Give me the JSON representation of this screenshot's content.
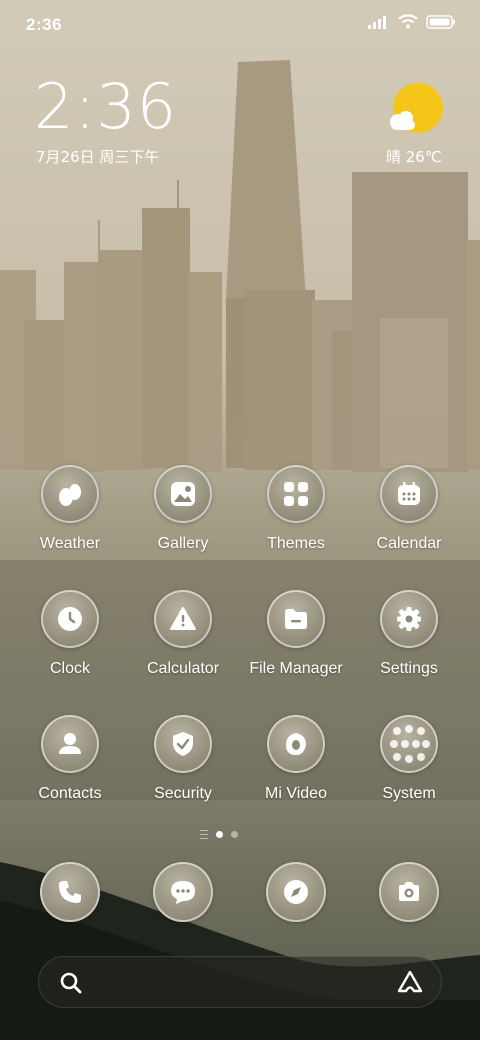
{
  "status_bar": {
    "time": "2:36"
  },
  "clock_widget": {
    "time": "2:36",
    "date": "7月26日 周三下午"
  },
  "weather_widget": {
    "condition_temp": "晴 26℃"
  },
  "apps": [
    {
      "label": "Weather",
      "icon": "weather-drops-icon"
    },
    {
      "label": "Gallery",
      "icon": "gallery-icon"
    },
    {
      "label": "Themes",
      "icon": "themes-grid-icon"
    },
    {
      "label": "Calendar",
      "icon": "calendar-icon"
    },
    {
      "label": "Clock",
      "icon": "clock-icon"
    },
    {
      "label": "Calculator",
      "icon": "calculator-icon"
    },
    {
      "label": "File Manager",
      "icon": "folder-icon"
    },
    {
      "label": "Settings",
      "icon": "gear-icon"
    },
    {
      "label": "Contacts",
      "icon": "person-icon"
    },
    {
      "label": "Security",
      "icon": "shield-check-icon"
    },
    {
      "label": "Mi Video",
      "icon": "video-icon"
    },
    {
      "label": "System",
      "icon": "folder-grid-icon"
    }
  ],
  "dock": [
    {
      "icon": "phone-icon"
    },
    {
      "icon": "messages-icon"
    },
    {
      "icon": "browser-compass-icon"
    },
    {
      "icon": "camera-icon"
    }
  ],
  "page_indicator": {
    "pages": 2,
    "active": 1
  },
  "colors": {
    "sun": "#f5c518",
    "icon_bg": "#8f8a77",
    "sky": "#cfc8b6"
  }
}
